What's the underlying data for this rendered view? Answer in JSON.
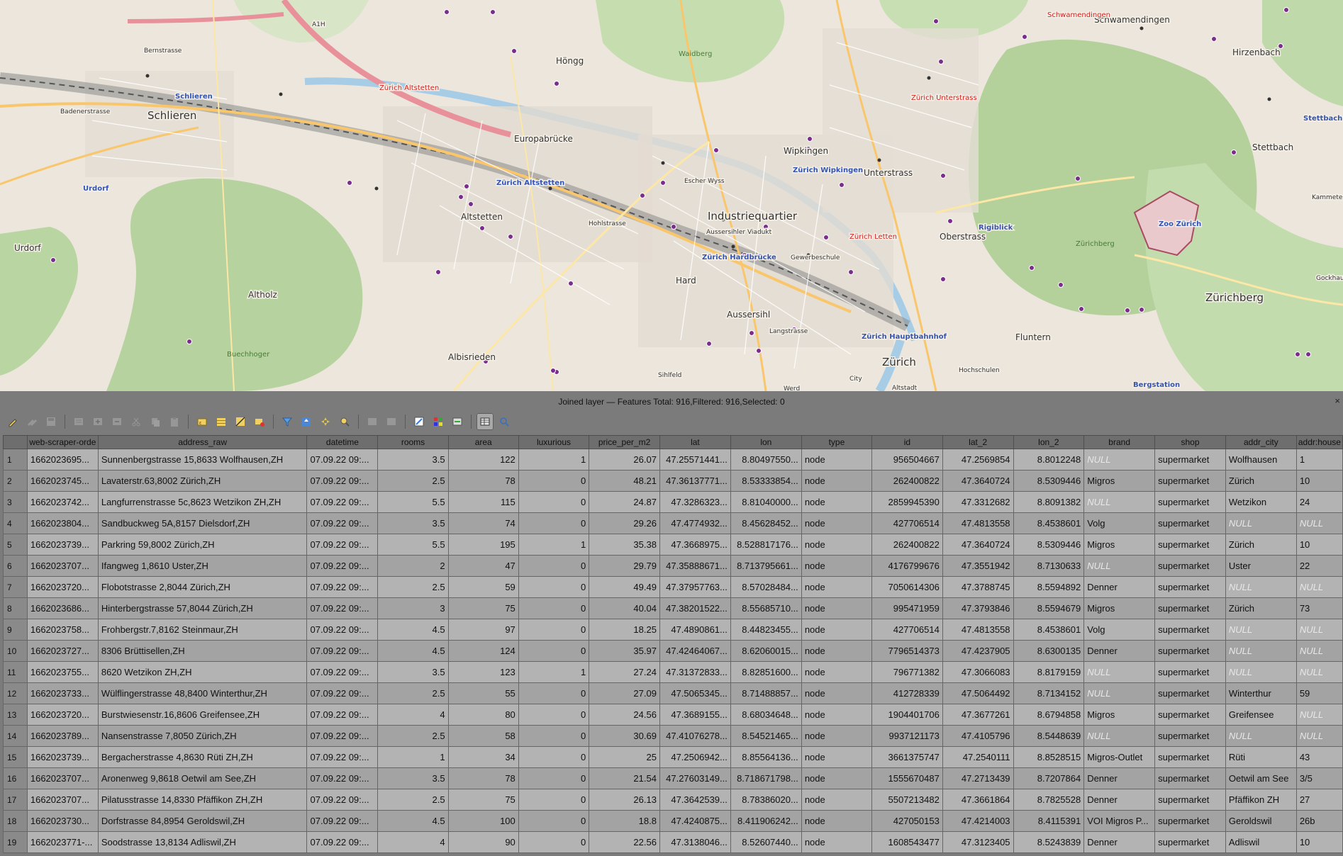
{
  "map": {
    "labels": {
      "schlieren": "Schlieren",
      "hongg": "Höngg",
      "wipkingen": "Wipkingen",
      "unterstrass": "Unterstrass",
      "oberstrass": "Oberstrass",
      "schwamendingen": "Schwamendingen",
      "hirzenbach": "Hirzenbach",
      "stettbach": "Stettbach",
      "urdorf": "Urdorf",
      "altstetten": "Altstetten",
      "industriequartier": "Industriequartier",
      "aussersihl": "Aussersihl",
      "hard": "Hard",
      "albisrieden": "Albisrieden",
      "zurich": "Zürich",
      "fluntern": "Fluntern",
      "zurichberg": "Zürichberg",
      "altholz": "Altholz",
      "europabrucke": "Europabrücke",
      "escher_wyss": "Escher Wyss",
      "langstrasse": "Langstrasse",
      "hochschulen": "Hochschulen",
      "sihlfeld": "Sihlfeld",
      "city": "City",
      "altstadt": "Altstadt",
      "werd": "Werd",
      "kammeten": "Kammeten",
      "gockhausen": "Gockhau",
      "a1h": "A1H",
      "bernstrasse": "Bernstrasse",
      "badenerstrasse": "Badenerstrasse",
      "hohlstrasse": "Hohlstrasse",
      "red_zurich_altstetten": "Zürich Altstetten",
      "red_zurich_letten": "Zürich Letten",
      "red_zurich_unterstrass": "Zürich Unterstrass",
      "red_schwamendingen": "Schwamendingen",
      "blue_zurich_altstetten": "Zürich Altstetten",
      "blue_hardbrucke": "Zürich Hardbrücke",
      "blue_hauptbahnhof": "Zürich Hauptbahnhof",
      "blue_wipkingen": "Zürich Wipkingen",
      "blue_schlieren": "Schlieren",
      "blue_urdorf": "Urdorf",
      "blue_rigiblick": "Rigiblick",
      "blue_zoo": "Zoo Zürich",
      "blue_stettbach": "Stettbach",
      "blue_bergstation": "Bergstation",
      "green_waidberg": "Waidberg",
      "green_zurichberg": "Zürichberg",
      "green_buechhoger": "Buechhoger",
      "aussersihler_viadukt": "Aussersihler Viadukt",
      "gewerbeschule": "Gewerbeschule"
    }
  },
  "panel": {
    "title": "Joined layer — Features Total: 916,Filtered: 916,Selected: 0",
    "close": "×",
    "toolbar": [
      {
        "name": "toggle-editing-icon",
        "active": false,
        "dim": false
      },
      {
        "name": "multi-edit-icon",
        "active": false,
        "dim": true
      },
      {
        "name": "save-edits-icon",
        "active": false,
        "dim": true
      },
      {
        "name": "reload-table-icon",
        "active": false,
        "dim": true
      },
      {
        "name": "add-feature-icon",
        "active": false,
        "dim": true
      },
      {
        "name": "delete-feature-icon",
        "active": false,
        "dim": true
      },
      {
        "name": "cut-icon",
        "active": false,
        "dim": true
      },
      {
        "name": "copy-icon",
        "active": false,
        "dim": true
      },
      {
        "name": "paste-icon",
        "active": false,
        "dim": true
      },
      {
        "name": "select-expression-icon",
        "active": false,
        "dim": false
      },
      {
        "name": "select-all-icon",
        "active": false,
        "dim": false
      },
      {
        "name": "invert-selection-icon",
        "active": false,
        "dim": false
      },
      {
        "name": "deselect-all-icon",
        "active": false,
        "dim": false
      },
      {
        "name": "filter-icon",
        "active": false,
        "dim": false
      },
      {
        "name": "move-selection-top-icon",
        "active": false,
        "dim": false
      },
      {
        "name": "pan-to-selected-icon",
        "active": false,
        "dim": false
      },
      {
        "name": "zoom-to-selected-icon",
        "active": false,
        "dim": false
      },
      {
        "name": "new-field-icon",
        "active": false,
        "dim": true
      },
      {
        "name": "delete-field-icon",
        "active": false,
        "dim": true
      },
      {
        "name": "field-calculator-icon",
        "active": false,
        "dim": false
      },
      {
        "name": "conditional-formatting-icon",
        "active": false,
        "dim": false
      },
      {
        "name": "actions-icon",
        "active": false,
        "dim": false
      },
      {
        "name": "table-view-icon",
        "active": true,
        "dim": false
      },
      {
        "name": "form-view-icon",
        "active": false,
        "dim": false
      }
    ]
  },
  "table": {
    "columns": [
      "web-scraper-orde",
      "address_raw",
      "datetime",
      "rooms",
      "area",
      "luxurious",
      "price_per_m2",
      "lat",
      "lon",
      "type",
      "id",
      "lat_2",
      "lon_2",
      "brand",
      "shop",
      "addr_city",
      "addr:house"
    ],
    "rows": [
      [
        "1",
        "1662023695...",
        "Sunnenbergstrasse 15,8633 Wolfhausen,ZH",
        "07.09.22 09:...",
        "3.5",
        "122",
        "1",
        "26.07",
        "47.25571441...",
        "8.80497550...",
        "node",
        "956504667",
        "47.2569854",
        "8.8012248",
        "NULL",
        "supermarket",
        "Wolfhausen",
        "1"
      ],
      [
        "2",
        "1662023745...",
        "Lavaterstr.63,8002 Zürich,ZH",
        "07.09.22 09:...",
        "2.5",
        "78",
        "0",
        "48.21",
        "47.36137771...",
        "8.53333854...",
        "node",
        "262400822",
        "47.3640724",
        "8.5309446",
        "Migros",
        "supermarket",
        "Zürich",
        "10"
      ],
      [
        "3",
        "1662023742...",
        "Langfurrenstrasse 5c,8623 Wetzikon ZH,ZH",
        "07.09.22 09:...",
        "5.5",
        "115",
        "0",
        "24.87",
        "47.3286323...",
        "8.81040000...",
        "node",
        "2859945390",
        "47.3312682",
        "8.8091382",
        "NULL",
        "supermarket",
        "Wetzikon",
        "24"
      ],
      [
        "4",
        "1662023804...",
        "Sandbuckweg 5A,8157 Dielsdorf,ZH",
        "07.09.22 09:...",
        "3.5",
        "74",
        "0",
        "29.26",
        "47.4774932...",
        "8.45628452...",
        "node",
        "427706514",
        "47.4813558",
        "8.4538601",
        "Volg",
        "supermarket",
        "NULL",
        "NULL"
      ],
      [
        "5",
        "1662023739...",
        "Parkring 59,8002 Zürich,ZH",
        "07.09.22 09:...",
        "5.5",
        "195",
        "1",
        "35.38",
        "47.3668975...",
        "8.528817176...",
        "node",
        "262400822",
        "47.3640724",
        "8.5309446",
        "Migros",
        "supermarket",
        "Zürich",
        "10"
      ],
      [
        "6",
        "1662023707...",
        "Ifangweg 1,8610 Uster,ZH",
        "07.09.22 09:...",
        "2",
        "47",
        "0",
        "29.79",
        "47.35888671...",
        "8.713795661...",
        "node",
        "4176799676",
        "47.3551942",
        "8.7130633",
        "NULL",
        "supermarket",
        "Uster",
        "22"
      ],
      [
        "7",
        "1662023720...",
        "Flobotstrasse 2,8044 Zürich,ZH",
        "07.09.22 09:...",
        "2.5",
        "59",
        "0",
        "49.49",
        "47.37957763...",
        "8.57028484...",
        "node",
        "7050614306",
        "47.3788745",
        "8.5594892",
        "Denner",
        "supermarket",
        "NULL",
        "NULL"
      ],
      [
        "8",
        "1662023686...",
        "Hinterbergstrasse 57,8044 Zürich,ZH",
        "07.09.22 09:...",
        "3",
        "75",
        "0",
        "40.04",
        "47.38201522...",
        "8.55685710...",
        "node",
        "995471959",
        "47.3793846",
        "8.5594679",
        "Migros",
        "supermarket",
        "Zürich",
        "73"
      ],
      [
        "9",
        "1662023758...",
        "Frohbergstr.7,8162 Steinmaur,ZH",
        "07.09.22 09:...",
        "4.5",
        "97",
        "0",
        "18.25",
        "47.4890861...",
        "8.44823455...",
        "node",
        "427706514",
        "47.4813558",
        "8.4538601",
        "Volg",
        "supermarket",
        "NULL",
        "NULL"
      ],
      [
        "10",
        "1662023727...",
        "8306 Brüttisellen,ZH",
        "07.09.22 09:...",
        "4.5",
        "124",
        "0",
        "35.97",
        "47.42464067...",
        "8.62060015...",
        "node",
        "7796514373",
        "47.4237905",
        "8.6300135",
        "Denner",
        "supermarket",
        "NULL",
        "NULL"
      ],
      [
        "11",
        "1662023755...",
        "8620 Wetzikon ZH,ZH",
        "07.09.22 09:...",
        "3.5",
        "123",
        "1",
        "27.24",
        "47.31372833...",
        "8.82851600...",
        "node",
        "796771382",
        "47.3066083",
        "8.8179159",
        "NULL",
        "supermarket",
        "NULL",
        "NULL"
      ],
      [
        "12",
        "1662023733...",
        "Wülflingerstrasse 48,8400 Winterthur,ZH",
        "07.09.22 09:...",
        "2.5",
        "55",
        "0",
        "27.09",
        "47.5065345...",
        "8.71488857...",
        "node",
        "412728339",
        "47.5064492",
        "8.7134152",
        "NULL",
        "supermarket",
        "Winterthur",
        "59"
      ],
      [
        "13",
        "1662023720...",
        "Burstwiesenstr.16,8606 Greifensee,ZH",
        "07.09.22 09:...",
        "4",
        "80",
        "0",
        "24.56",
        "47.3689155...",
        "8.68034648...",
        "node",
        "1904401706",
        "47.3677261",
        "8.6794858",
        "Migros",
        "supermarket",
        "Greifensee",
        "NULL"
      ],
      [
        "14",
        "1662023789...",
        "Nansenstrasse 7,8050 Zürich,ZH",
        "07.09.22 09:...",
        "2.5",
        "58",
        "0",
        "30.69",
        "47.41076278...",
        "8.54521465...",
        "node",
        "9937121173",
        "47.4105796",
        "8.5448639",
        "NULL",
        "supermarket",
        "NULL",
        "NULL"
      ],
      [
        "15",
        "1662023739...",
        "Bergacherstrasse 4,8630 Rüti ZH,ZH",
        "07.09.22 09:...",
        "1",
        "34",
        "0",
        "25",
        "47.2506942...",
        "8.85564136...",
        "node",
        "3661375747",
        "47.2540111",
        "8.8528515",
        "Migros-Outlet",
        "supermarket",
        "Rüti",
        "43"
      ],
      [
        "16",
        "1662023707...",
        "Aronenweg 9,8618 Oetwil am See,ZH",
        "07.09.22 09:...",
        "3.5",
        "78",
        "0",
        "21.54",
        "47.27603149...",
        "8.718671798...",
        "node",
        "1555670487",
        "47.2713439",
        "8.7207864",
        "Denner",
        "supermarket",
        "Oetwil am See",
        "3/5"
      ],
      [
        "17",
        "1662023707...",
        "Pilatusstrasse 14,8330 Pfäffikon ZH,ZH",
        "07.09.22 09:...",
        "2.5",
        "75",
        "0",
        "26.13",
        "47.3642539...",
        "8.78386020...",
        "node",
        "5507213482",
        "47.3661864",
        "8.7825528",
        "Denner",
        "supermarket",
        "Pfäffikon ZH",
        "27"
      ],
      [
        "18",
        "1662023730...",
        "Dorfstrasse 84,8954 Geroldswil,ZH",
        "07.09.22 09:...",
        "4.5",
        "100",
        "0",
        "18.8",
        "47.4240875...",
        "8.411906242...",
        "node",
        "427050153",
        "47.4214003",
        "8.4115391",
        "VOI Migros P...",
        "supermarket",
        "Geroldswil",
        "26b"
      ],
      [
        "19",
        "1662023771-...",
        "Soodstrasse 13,8134 Adliswil,ZH",
        "07.09.22 09:...",
        "4",
        "90",
        "0",
        "22.56",
        "47.3138046...",
        "8.52607440...",
        "node",
        "1608543477",
        "47.3123405",
        "8.5243839",
        "Denner",
        "supermarket",
        "Adliswil",
        "10"
      ]
    ]
  }
}
